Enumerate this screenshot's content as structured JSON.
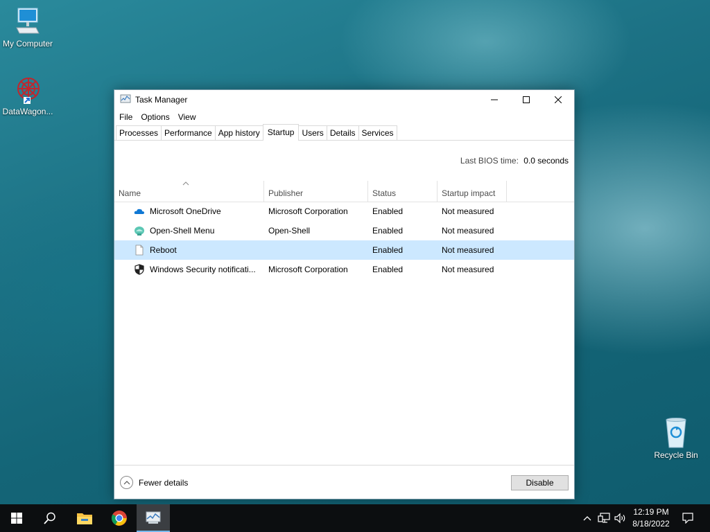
{
  "desktop": {
    "icons": [
      {
        "label": "My Computer",
        "icon": "computer-icon"
      },
      {
        "label": "DataWagon...",
        "icon": "datawagon-icon"
      },
      {
        "label": "Recycle Bin",
        "icon": "recycle-bin-icon"
      }
    ]
  },
  "window": {
    "title": "Task Manager",
    "menu": [
      "File",
      "Options",
      "View"
    ],
    "tabs": [
      "Processes",
      "Performance",
      "App history",
      "Startup",
      "Users",
      "Details",
      "Services"
    ],
    "active_tab": "Startup",
    "bios_label": "Last BIOS time:",
    "bios_value": "0.0 seconds",
    "columns": [
      "Name",
      "Publisher",
      "Status",
      "Startup impact"
    ],
    "rows": [
      {
        "name": "Microsoft OneDrive",
        "publisher": "Microsoft Corporation",
        "status": "Enabled",
        "impact": "Not measured",
        "icon": "onedrive-icon",
        "selected": false
      },
      {
        "name": "Open-Shell Menu",
        "publisher": "Open-Shell",
        "status": "Enabled",
        "impact": "Not measured",
        "icon": "open-shell-icon",
        "selected": false
      },
      {
        "name": "Reboot",
        "publisher": "",
        "status": "Enabled",
        "impact": "Not measured",
        "icon": "file-icon",
        "selected": true
      },
      {
        "name": "Windows Security notificati...",
        "publisher": "Microsoft Corporation",
        "status": "Enabled",
        "impact": "Not measured",
        "icon": "shield-icon",
        "selected": false
      }
    ],
    "fewer_details": "Fewer details",
    "disable_button": "Disable"
  },
  "taskbar": {
    "items": [
      "start-icon",
      "search-icon",
      "file-explorer-icon",
      "chrome-icon",
      "task-manager-icon"
    ],
    "time": "12:19 PM",
    "date": "8/18/2022"
  },
  "colors": {
    "selection": "#cce8ff",
    "taskbar": "#0c0e10",
    "accent": "#76b9ed"
  }
}
